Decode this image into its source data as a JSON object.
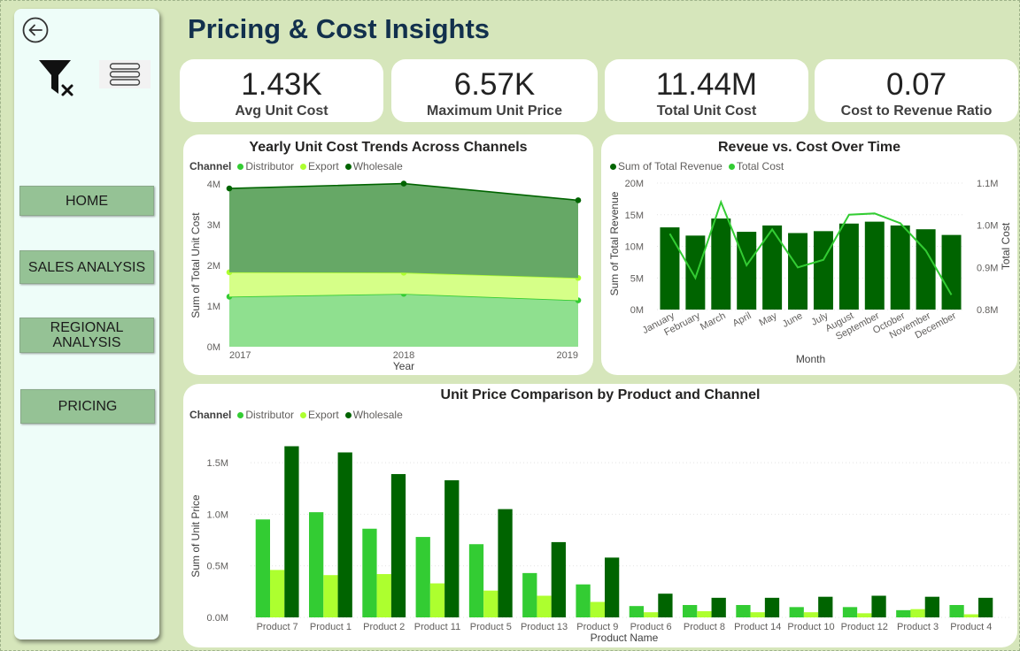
{
  "page": {
    "title": "Pricing & Cost Insights"
  },
  "sidebar": {
    "items": [
      {
        "label": "HOME"
      },
      {
        "label": "SALES ANALYSIS"
      },
      {
        "label": "REGIONAL ANALYSIS"
      },
      {
        "label": "PRICING"
      }
    ]
  },
  "kpis": [
    {
      "value": "1.43K",
      "label": "Avg Unit Cost"
    },
    {
      "value": "6.57K",
      "label": "Maximum Unit Price"
    },
    {
      "value": "11.44M",
      "label": "Total Unit Cost"
    },
    {
      "value": "0.07",
      "label": "Cost to Revenue Ratio"
    }
  ],
  "colors": {
    "distributor": "#33cc33",
    "export": "#adff2f",
    "wholesale": "#006400",
    "revenue_bar": "#006400",
    "cost_line": "#33cc33"
  },
  "chart_data": [
    {
      "type": "area",
      "title": "Yearly Unit Cost Trends Across Channels",
      "legend_title": "Channel",
      "x": [
        2017,
        2018,
        2019
      ],
      "xlabel": "Year",
      "ylabel": "Sum of Total Unit Cost",
      "yticks": [
        "0M",
        "1M",
        "2M",
        "3M",
        "4M"
      ],
      "ylim": [
        0,
        4000000
      ],
      "stacked": true,
      "series": [
        {
          "name": "Distributor",
          "values": [
            1230000,
            1300000,
            1140000
          ]
        },
        {
          "name": "Export",
          "values": [
            600000,
            520000,
            550000
          ]
        },
        {
          "name": "Wholesale",
          "values": [
            2060000,
            2190000,
            1910000
          ]
        }
      ]
    },
    {
      "type": "bar",
      "title": "Reveue vs. Cost Over Time",
      "categories": [
        "January",
        "February",
        "March",
        "April",
        "May",
        "June",
        "July",
        "August",
        "September",
        "October",
        "November",
        "December"
      ],
      "xlabel": "Month",
      "ylabel": "Sum of Total Revenue",
      "y2label": "Total Cost",
      "yticks": [
        "0M",
        "5M",
        "10M",
        "15M",
        "20M"
      ],
      "y2ticks": [
        "0.8M",
        "0.9M",
        "1.0M",
        "1.1M"
      ],
      "ylim": [
        0,
        20000000
      ],
      "y2lim": [
        800000,
        1100000
      ],
      "series": [
        {
          "name": "Sum of Total Revenue",
          "kind": "bar",
          "values": [
            13000000,
            11700000,
            14400000,
            12300000,
            13300000,
            12100000,
            12400000,
            13600000,
            13900000,
            13300000,
            12700000,
            11800000
          ]
        },
        {
          "name": "Total Cost",
          "kind": "line",
          "axis": "y2",
          "values": [
            980000,
            875000,
            1055000,
            905000,
            990000,
            900000,
            918000,
            1025000,
            1028000,
            1005000,
            940000,
            835000
          ]
        }
      ]
    },
    {
      "type": "bar",
      "title": "Unit Price Comparison by Product and Channel",
      "legend_title": "Channel",
      "categories": [
        "Product 7",
        "Product 1",
        "Product 2",
        "Product 11",
        "Product 5",
        "Product 13",
        "Product 9",
        "Product 6",
        "Product 8",
        "Product 14",
        "Product 10",
        "Product 12",
        "Product 3",
        "Product 4"
      ],
      "xlabel": "Product Name",
      "ylabel": "Sum of Unit Price",
      "yticks": [
        "0.0M",
        "0.5M",
        "1.0M",
        "1.5M"
      ],
      "ylim": [
        0,
        1750000
      ],
      "series": [
        {
          "name": "Distributor",
          "values": [
            950000,
            1020000,
            860000,
            780000,
            710000,
            430000,
            320000,
            110000,
            120000,
            120000,
            100000,
            100000,
            70000,
            120000
          ]
        },
        {
          "name": "Export",
          "values": [
            460000,
            410000,
            420000,
            330000,
            260000,
            210000,
            150000,
            50000,
            60000,
            50000,
            50000,
            40000,
            80000,
            30000
          ]
        },
        {
          "name": "Wholesale",
          "values": [
            1660000,
            1600000,
            1390000,
            1330000,
            1050000,
            730000,
            580000,
            230000,
            190000,
            190000,
            200000,
            210000,
            200000,
            190000
          ]
        }
      ]
    }
  ]
}
